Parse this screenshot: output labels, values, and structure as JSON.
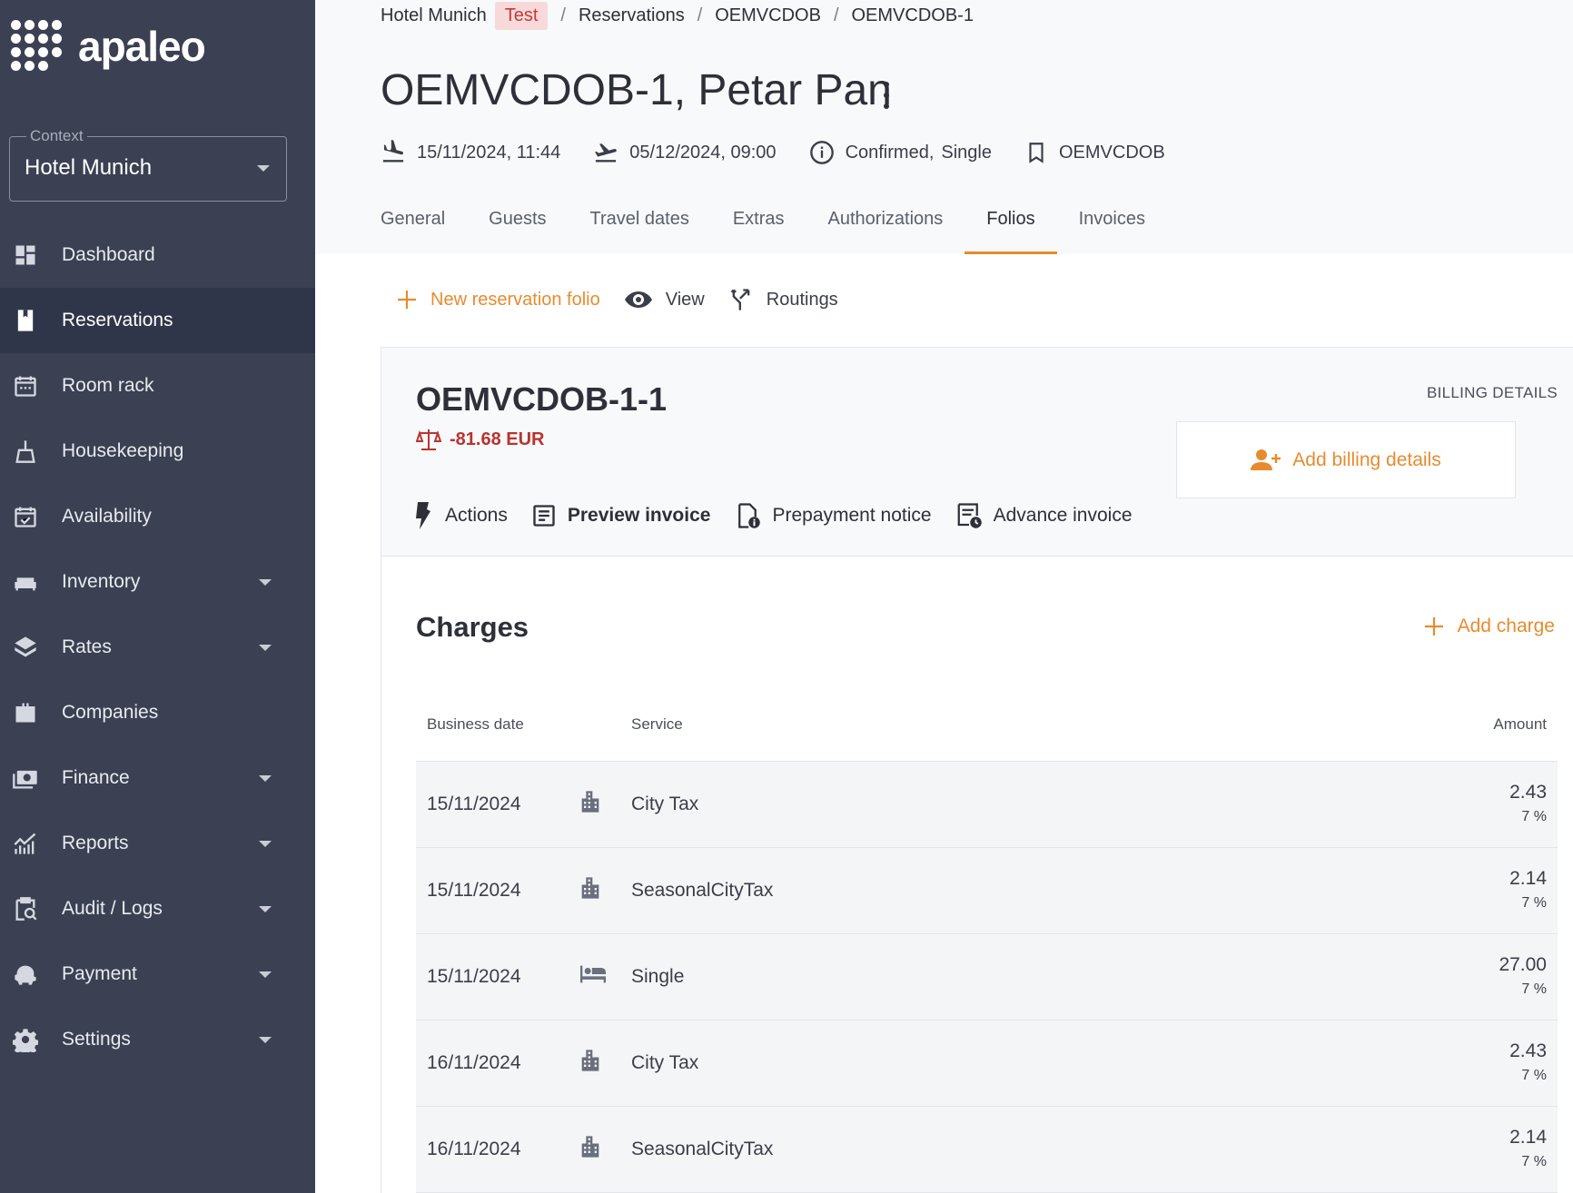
{
  "app": {
    "logo_text": "apaleo"
  },
  "context": {
    "legend": "Context",
    "value": "Hotel Munich"
  },
  "sidebar": {
    "items": [
      {
        "label": "Dashboard",
        "icon": "dashboard-icon",
        "expandable": false,
        "active": false
      },
      {
        "label": "Reservations",
        "icon": "book-icon",
        "expandable": false,
        "active": true
      },
      {
        "label": "Room rack",
        "icon": "calendar-icon",
        "expandable": false,
        "active": false
      },
      {
        "label": "Housekeeping",
        "icon": "broom-icon",
        "expandable": false,
        "active": false
      },
      {
        "label": "Availability",
        "icon": "calendar-check-icon",
        "expandable": false,
        "active": false
      },
      {
        "label": "Inventory",
        "icon": "sofa-icon",
        "expandable": true,
        "active": false
      },
      {
        "label": "Rates",
        "icon": "layers-icon",
        "expandable": true,
        "active": false
      },
      {
        "label": "Companies",
        "icon": "briefcase-icon",
        "expandable": false,
        "active": false
      },
      {
        "label": "Finance",
        "icon": "money-icon",
        "expandable": true,
        "active": false
      },
      {
        "label": "Reports",
        "icon": "chart-icon",
        "expandable": true,
        "active": false
      },
      {
        "label": "Audit / Logs",
        "icon": "audit-icon",
        "expandable": true,
        "active": false
      },
      {
        "label": "Payment",
        "icon": "piggy-bank-icon",
        "expandable": true,
        "active": false
      },
      {
        "label": "Settings",
        "icon": "gear-icon",
        "expandable": true,
        "active": false
      }
    ]
  },
  "breadcrumb": {
    "hotel": "Hotel Munich",
    "badge": "Test",
    "items": [
      "Reservations",
      "OEMVCDOB",
      "OEMVCDOB-1"
    ]
  },
  "header": {
    "title": "OEMVCDOB-1, Petar Pan",
    "arrival": "15/11/2024, 11:44",
    "departure": "05/12/2024, 09:00",
    "status": "Confirmed,",
    "unit": "Single",
    "booking": "OEMVCDOB"
  },
  "tabs": [
    {
      "label": "General",
      "active": false
    },
    {
      "label": "Guests",
      "active": false
    },
    {
      "label": "Travel dates",
      "active": false
    },
    {
      "label": "Extras",
      "active": false
    },
    {
      "label": "Authorizations",
      "active": false
    },
    {
      "label": "Folios",
      "active": true
    },
    {
      "label": "Invoices",
      "active": false
    }
  ],
  "toolbar": {
    "new_folio": "New reservation folio",
    "view": "View",
    "routings": "Routings"
  },
  "folio": {
    "id": "OEMVCDOB-1-1",
    "balance": "-81.68 EUR",
    "billing_title": "BILLING DETAILS",
    "add_billing": "Add billing details",
    "actions": "Actions",
    "preview_invoice": "Preview invoice",
    "prepayment_notice": "Prepayment notice",
    "advance_invoice": "Advance invoice"
  },
  "charges": {
    "title": "Charges",
    "add_charge": "Add charge",
    "columns": {
      "date": "Business date",
      "service": "Service",
      "amount": "Amount"
    },
    "rows": [
      {
        "date": "15/11/2024",
        "icon": "building-icon",
        "service": "City Tax",
        "amount": "2.43",
        "vat": "7 %"
      },
      {
        "date": "15/11/2024",
        "icon": "building-icon",
        "service": "SeasonalCityTax",
        "amount": "2.14",
        "vat": "7 %"
      },
      {
        "date": "15/11/2024",
        "icon": "bed-icon",
        "service": "Single",
        "amount": "27.00",
        "vat": "7 %"
      },
      {
        "date": "16/11/2024",
        "icon": "building-icon",
        "service": "City Tax",
        "amount": "2.43",
        "vat": "7 %"
      },
      {
        "date": "16/11/2024",
        "icon": "building-icon",
        "service": "SeasonalCityTax",
        "amount": "2.14",
        "vat": "7 %"
      }
    ]
  },
  "colors": {
    "sidebar": "#3b4153",
    "accent": "#e88b2e",
    "negative": "#b8342f"
  }
}
